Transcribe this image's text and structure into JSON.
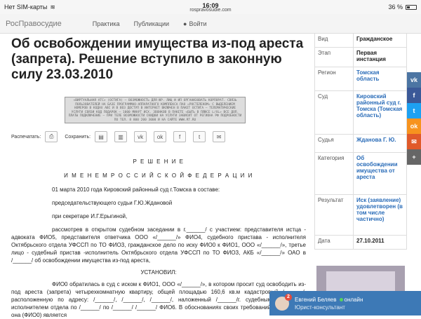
{
  "status": {
    "carrier": "Нет SIM-карты",
    "time": "16:09",
    "url": "rospravosudie.com",
    "battery": "36 %",
    "battery_level": 0.36
  },
  "nav": {
    "brand": "РосПравосудие",
    "practice": "Практика",
    "publications": "Публикации",
    "login": "Войти"
  },
  "title": "Об освобождении имущества из-под ареста (запрета). Решение вступило в законную силу 23.03.2010",
  "banner_text": "«ВИРТУАЛЬНАЯ АТС» (ОСТИГА) — ВОЗМОЖНОСТЬ ДЛЯ ЮР. ЛИЦ И ИП ОРГАНИЗОВАТЬ КОРПОРАТ. СВЯЗЬ ПОЛЬЗОВАТЕЛЕЙ НА БАЗЕ ПРОГРАММНО-АППАРАТНОГО КОМПЛЕКСА ПАО «РОСТЕЛЕКОМ» С ВЫДЕЛЕНИЕМ НОМЕРОВ В КОДАХ АВС И В ВОЗ ДОСТУП В ИНТЕРНЕТ ВКЛЮЧЕН В ПАКЕТ ОСТИГА — ТЕЛЕМАТИЧЕСКИЕ УСЛУГИ СВЯЗИ КОД ПОДАРОК — 1000 МИНУТ ИСХ. ЗВОНКОВ В ПАКЕТЕ «БЫТЬ В ПЛЮСЕ L/XL» ВСЕ ДОП. ПЛАТЫ ПОДКЛЮЧЕНИЕ — ПРИ ТЕЛЕ ВОЗМОЖНОСТИ СКИДКИ НА УСЛУГИ ЗАВИСИТ ОТ РЕГИОНА РФ ПОДРОБНОСТИ ПО ТЕЛ. 8 800 200 3000 И НА САЙТЕ WWW.RT.RU",
  "toolbar": {
    "print_label": "Распечатать:",
    "save_label": "Сохранить:",
    "save_items": [
      "doc",
      "pdf",
      "vk",
      "ok",
      "fb",
      "tw",
      "mail"
    ]
  },
  "document": {
    "heading": "Р Е Ш Е Н И Е",
    "subheading": "И М Е Н Е М Р О С С И Й С К О Й Ф Е Д Е Р А Ц И И",
    "paragraphs": [
      "01 марта 2010 года Кировский районный суд г.Томска в составе:",
      "председательствующего судьи Г.Ю.Ждановой",
      "при секретаре И.Г.Ерыгиной,",
      "рассмотрев в открытом судебном заседании в г.______/ с участием: представителя истца - адвоката ФИО5, представителя ответчика ООО «/______/» ФИО4, судебного пристава - исполнителя Октябрьского отдела УФССП по ТО ФИО3, гражданское дело по иску ФИО0 к ФИО1, ООО «/______/», третье лицо - судебный пристав -исполнитель Октябрьского отдела УФССП по ТО ФИО3, АКБ «/______/» ОАО в /______/ об освобождении имущества из-под ареста,",
      "УСТАНОВИЛ:",
      "ФИО0 обратилась в суд с иском к ФИО1, ООО «/______/», в котором просит суд освободить из-под ареста (запрета) четырехкомнатную квартиру, общей площадью 160,6 кв.м кадастровый /______/, расположенную по адресу: /______/, /______/, /______/, наложенный /______/г. судебным приставом-исполнителем отдела по /______/ по /______/ /______/ ФИО6. В обоснованиях своих требований указала, что она (ФИО0) является"
    ]
  },
  "sidebar": {
    "rows": [
      {
        "k": "Вид",
        "v": "Гражданское"
      },
      {
        "k": "Этап",
        "v": "Первая инстанция"
      },
      {
        "k": "Регион",
        "v": "Томская область"
      },
      {
        "k": "Суд",
        "v": "Кировский районный суд г. Томска (Томская область)"
      },
      {
        "k": "Судья",
        "v": "Жданова Г. Ю."
      },
      {
        "k": "Категория",
        "v": "Об освобождении имущества от ареста"
      },
      {
        "k": "Результат",
        "v": "Иск (заявление) удовлетворен (в том числе частично)"
      },
      {
        "k": "Дата",
        "v": "27.10.2011"
      }
    ]
  },
  "social": [
    {
      "name": "vk-icon",
      "glyph": "vk",
      "color": "#4c75a3"
    },
    {
      "name": "facebook-icon",
      "glyph": "f",
      "color": "#3b5998"
    },
    {
      "name": "twitter-icon",
      "glyph": "t",
      "color": "#1da1f2"
    },
    {
      "name": "odnoklassniki-icon",
      "glyph": "ok",
      "color": "#f7931e"
    },
    {
      "name": "mail-icon",
      "glyph": "✉",
      "color": "#e05a2a"
    },
    {
      "name": "more-icon",
      "glyph": "+",
      "color": "#666666"
    }
  ],
  "chat": {
    "name": "Евгений Беляев",
    "status": "онлайн",
    "role": "Юрист-консультант",
    "badge": "2"
  }
}
